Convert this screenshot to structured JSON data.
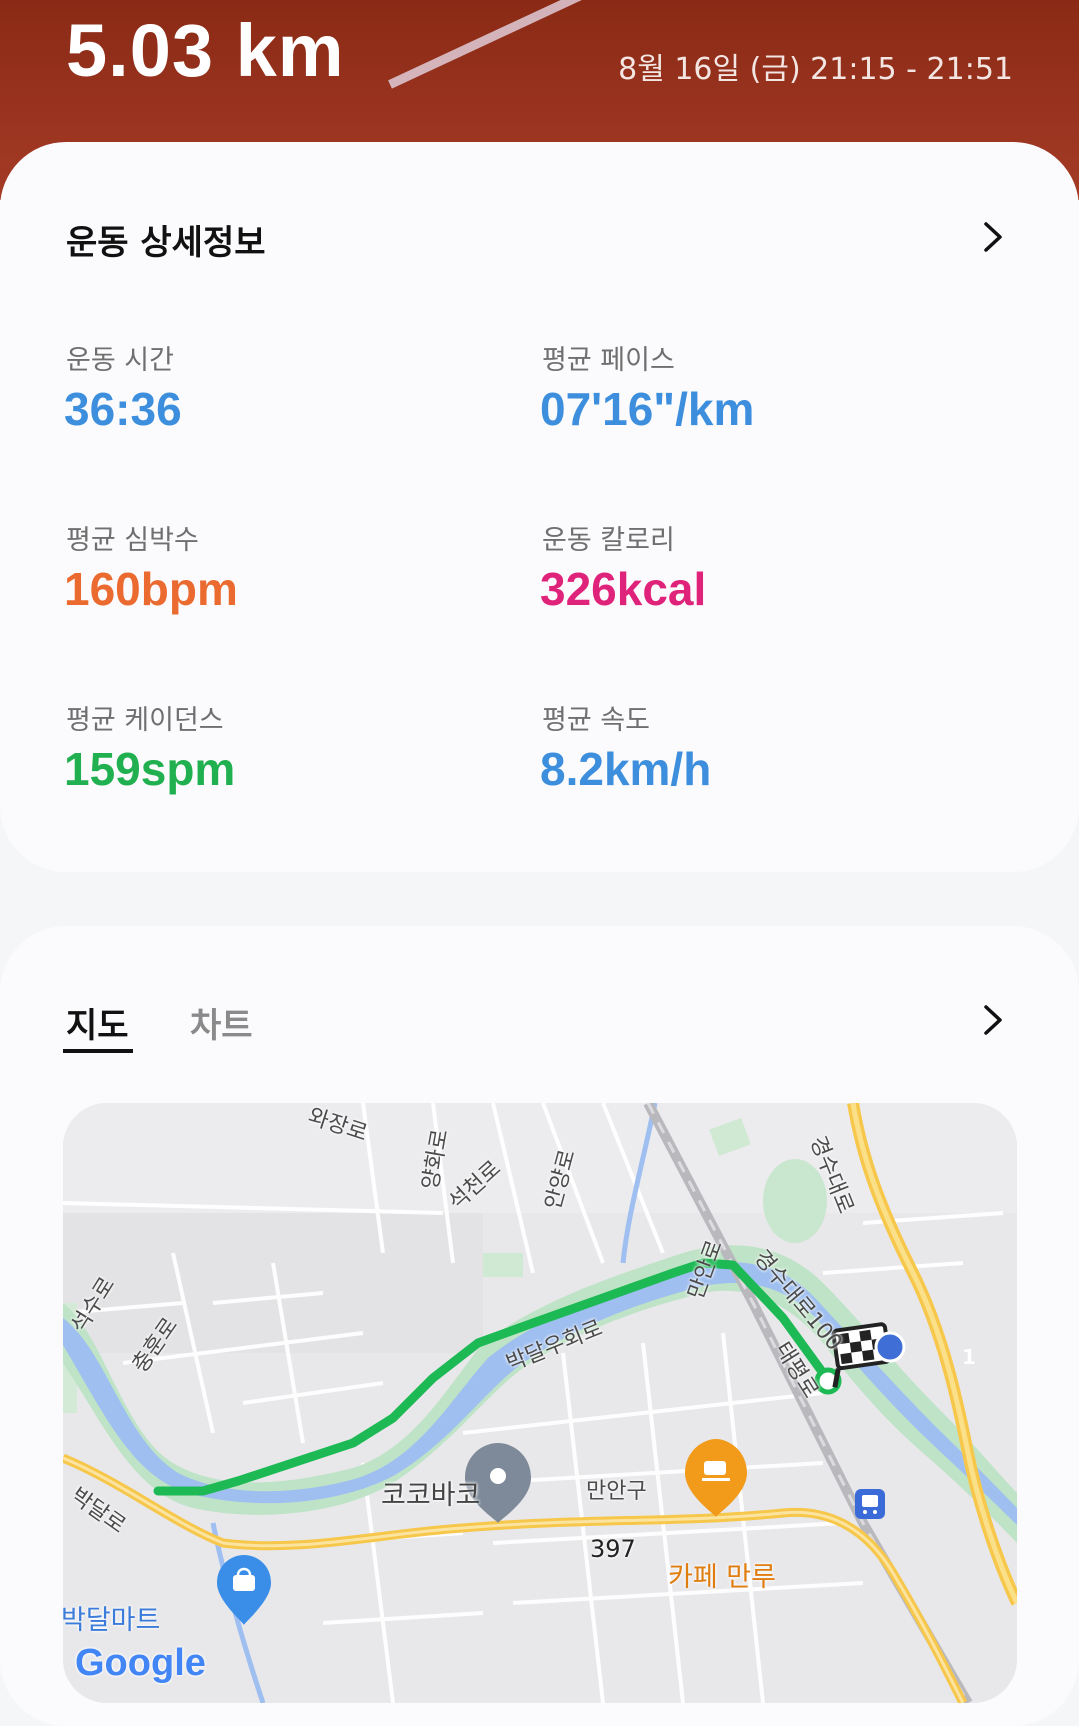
{
  "hero": {
    "distance": "5.03 km",
    "datetime": "8월 16일 (금) 21:15 - 21:51"
  },
  "details": {
    "title": "운동 상세정보",
    "stats": [
      {
        "label": "운동 시간",
        "value": "36:36",
        "color": "#3d8fdd"
      },
      {
        "label": "평균 페이스",
        "value": "07'16\"/km",
        "color": "#3d8fdd"
      },
      {
        "label": "평균 심박수",
        "value": "160bpm",
        "color": "#ea6a2f"
      },
      {
        "label": "운동 칼로리",
        "value": "326kcal",
        "color": "#e0237a"
      },
      {
        "label": "평균 케이던스",
        "value": "159spm",
        "color": "#21b04f"
      },
      {
        "label": "평균 속도",
        "value": "8.2km/h",
        "color": "#3d8fdd"
      }
    ]
  },
  "map_section": {
    "tabs": [
      {
        "label": "지도",
        "active": true
      },
      {
        "label": "차트",
        "active": false
      }
    ]
  },
  "map": {
    "road_labels": [
      "와장로",
      "양화로",
      "석천로",
      "안양로",
      "석수로",
      "충훈로",
      "박달우회로",
      "만안로",
      "경수대로",
      "경수대로100",
      "태평로",
      "박달로",
      "만안구",
      "397"
    ],
    "pois": [
      {
        "name": "코코바코",
        "icon": "map-pin-icon",
        "color": "#7e8a99"
      },
      {
        "name": "카페 만루",
        "icon": "cafe-icon",
        "color": "#f29b1a"
      },
      {
        "name": "박달마트",
        "icon": "shopping-bag-icon",
        "color": "#3b8ee8"
      }
    ],
    "route_color": "#1db954",
    "highway_badge": "1",
    "attribution": "Google",
    "finish_icon": "checkered-flag-icon",
    "transit_icon": "train-icon"
  }
}
